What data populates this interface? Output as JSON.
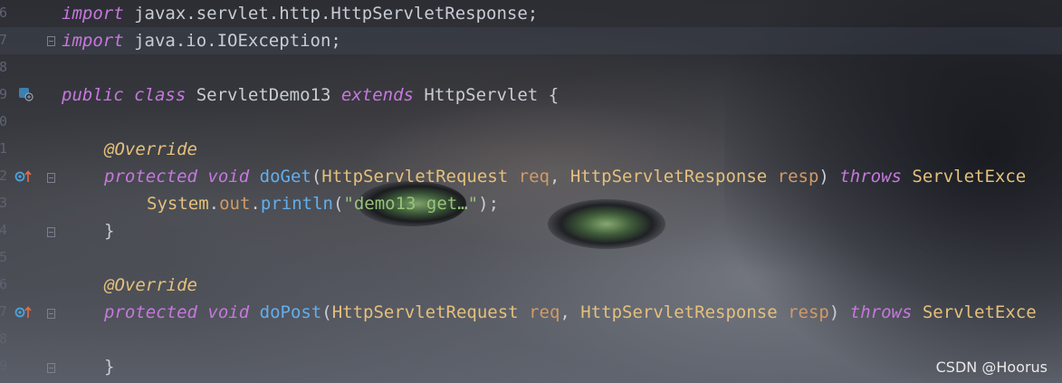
{
  "gutter": {
    "line_numbers": [
      "6",
      "7",
      "8",
      "9",
      "0",
      "1",
      "2",
      "3",
      "4",
      "5",
      "6",
      "7",
      "8",
      "9"
    ]
  },
  "code": {
    "line1": {
      "kw": "import",
      "rest": " javax.servlet.http.HttpServletResponse;"
    },
    "line2": {
      "kw": "import",
      "rest": " java.io.IOException;"
    },
    "line4": {
      "kw1": "public",
      "sp1": " ",
      "kw2": "class",
      "name": " ServletDemo13 ",
      "kw3": "extends",
      "type": " HttpServlet",
      "rest": " {"
    },
    "line6": {
      "annotation": "@Override"
    },
    "line7": {
      "kw1": "protected",
      "sp1": " ",
      "kw2": "void",
      "sp2": " ",
      "fn": "doGet",
      "p1": "(",
      "t1": "HttpServletRequest",
      "sp3": " ",
      "v1": "req",
      "p2": ", ",
      "t2": "HttpServletResponse",
      "sp4": " ",
      "v2": "resp",
      "p3": ") ",
      "kw3": "throws",
      "sp5": " ",
      "t3": "ServletExce"
    },
    "line8": {
      "cls": "System",
      "dot1": ".",
      "field": "out",
      "dot2": ".",
      "fn": "println",
      "p1": "(",
      "str": "\"demo13 get…\"",
      "p2": ");"
    },
    "line9": {
      "brace": "}"
    },
    "line11": {
      "annotation": "@Override"
    },
    "line12": {
      "kw1": "protected",
      "sp1": " ",
      "kw2": "void",
      "sp2": " ",
      "fn": "doPost",
      "p1": "(",
      "t1": "HttpServletRequest",
      "sp3": " ",
      "v1": "req",
      "p2": ", ",
      "t2": "HttpServletResponse",
      "sp4": " ",
      "v2": "resp",
      "p3": ") ",
      "kw3": "throws",
      "sp5": " ",
      "t3": "ServletExce"
    },
    "line14": {
      "brace": "}"
    }
  },
  "watermark": "CSDN @Hoorus",
  "colors": {
    "keyword": "#c678dd",
    "type": "#e5c07b",
    "function": "#61afef",
    "parameter": "#d19a66",
    "string": "#98c379",
    "text": "#c8ccd4"
  },
  "icons": {
    "class_gutter": "class-overrides-icon",
    "method_gutter": "override-method-icon",
    "fold": "fold-marker-icon"
  }
}
